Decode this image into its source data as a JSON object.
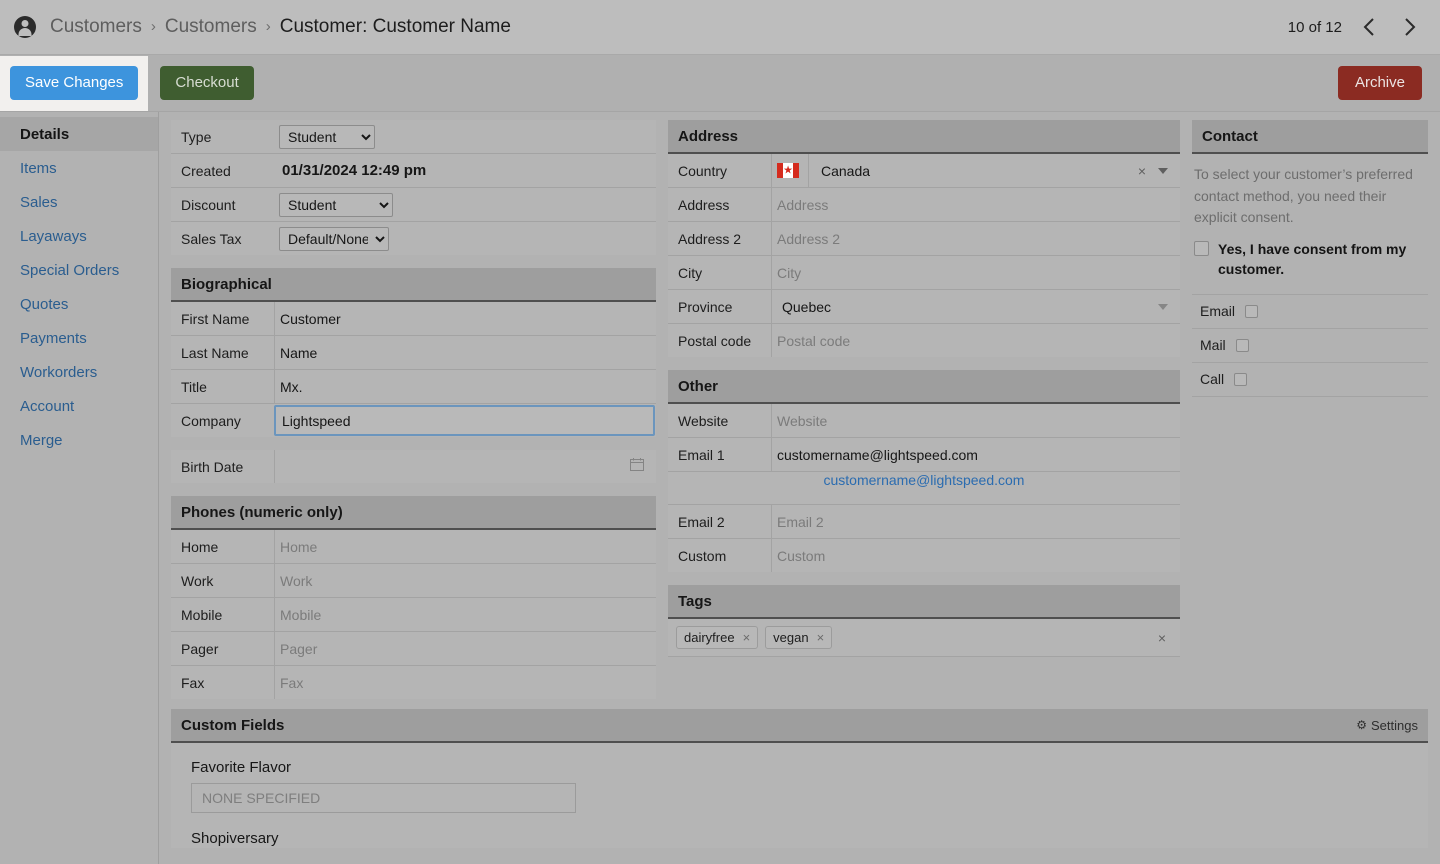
{
  "header": {
    "avatar_icon": "person-circle-icon",
    "breadcrumb": [
      {
        "label": "Customers",
        "current": false
      },
      {
        "label": "Customers",
        "current": false
      },
      {
        "label": "Customer: Customer Name",
        "current": true
      }
    ],
    "separator": "›",
    "pager": "10 of 12",
    "prev_icon": "chevron-left-icon",
    "next_icon": "chevron-right-icon"
  },
  "toolbar": {
    "save_label": "Save Changes",
    "checkout_label": "Checkout",
    "archive_label": "Archive",
    "save_color": "#3d94dd",
    "checkout_color": "#3f5d30",
    "archive_color": "#8b2b22"
  },
  "sidebar": {
    "items": [
      {
        "label": "Details",
        "active": true
      },
      {
        "label": "Items",
        "active": false
      },
      {
        "label": "Sales",
        "active": false
      },
      {
        "label": "Layaways",
        "active": false
      },
      {
        "label": "Special Orders",
        "active": false
      },
      {
        "label": "Quotes",
        "active": false
      },
      {
        "label": "Payments",
        "active": false
      },
      {
        "label": "Workorders",
        "active": false
      },
      {
        "label": "Account",
        "active": false
      },
      {
        "label": "Merge",
        "active": false
      }
    ],
    "link_color": "#2a5d8f"
  },
  "top_fields": {
    "type_label": "Type",
    "type_value": "Student",
    "created_label": "Created",
    "created_value": "01/31/2024 12:49 pm",
    "discount_label": "Discount",
    "discount_value": "Student",
    "sales_tax_label": "Sales Tax",
    "sales_tax_value": "Default/None"
  },
  "biographical": {
    "title": "Biographical",
    "rows": [
      {
        "label": "First Name",
        "value": "Customer",
        "placeholder": ""
      },
      {
        "label": "Last Name",
        "value": "Name",
        "placeholder": ""
      },
      {
        "label": "Title",
        "value": "Mx.",
        "placeholder": ""
      }
    ],
    "company_label": "Company",
    "company_value": "Lightspeed",
    "birth_date_label": "Birth Date",
    "birth_date_value": "",
    "calendar_icon": "calendar-icon",
    "focus_color": "#6b95bd"
  },
  "phones": {
    "title": "Phones (numeric only)",
    "rows": [
      {
        "label": "Home",
        "placeholder": "Home"
      },
      {
        "label": "Work",
        "placeholder": "Work"
      },
      {
        "label": "Mobile",
        "placeholder": "Mobile"
      },
      {
        "label": "Pager",
        "placeholder": "Pager"
      },
      {
        "label": "Fax",
        "placeholder": "Fax"
      }
    ]
  },
  "address": {
    "title": "Address",
    "country_label": "Country",
    "country_value": "Canada",
    "country_flag": "canada-flag-icon",
    "clear_icon": "clear-icon",
    "dropdown_icon": "chevron-down-icon",
    "rows": [
      {
        "label": "Address",
        "placeholder": "Address"
      },
      {
        "label": "Address 2",
        "placeholder": "Address 2"
      },
      {
        "label": "City",
        "placeholder": "City"
      }
    ],
    "province_label": "Province",
    "province_value": "Quebec",
    "postal_label": "Postal code",
    "postal_placeholder": "Postal code"
  },
  "other": {
    "title": "Other",
    "website_label": "Website",
    "website_placeholder": "Website",
    "email1_label": "Email 1",
    "email1_value": "customername@lightspeed.com",
    "email_link": "customername@lightspeed.com",
    "email2_label": "Email 2",
    "email2_placeholder": "Email 2",
    "custom_label": "Custom",
    "custom_placeholder": "Custom",
    "link_color": "#2b6cb0"
  },
  "tags": {
    "title": "Tags",
    "chips": [
      {
        "label": "dairyfree",
        "remove_icon": "remove-tag-icon"
      },
      {
        "label": "vegan",
        "remove_icon": "remove-tag-icon"
      }
    ],
    "clear_all_icon": "clear-all-tags-icon",
    "x_glyph": "×"
  },
  "contact": {
    "title": "Contact",
    "note": "To select your customer’s preferred contact method, you need their explicit consent.",
    "consent_label": "Yes, I have consent from my customer.",
    "consent_checked": false,
    "methods": [
      {
        "label": "Email",
        "checked": false
      },
      {
        "label": "Mail",
        "checked": false
      },
      {
        "label": "Call",
        "checked": false
      }
    ]
  },
  "custom_fields": {
    "title": "Custom Fields",
    "settings_label": "Settings",
    "settings_icon": "gear-icon",
    "fields": [
      {
        "label": "Favorite Flavor",
        "placeholder": "NONE SPECIFIED",
        "value": ""
      },
      {
        "label": "Shopiversary",
        "placeholder": "",
        "value": ""
      }
    ]
  }
}
